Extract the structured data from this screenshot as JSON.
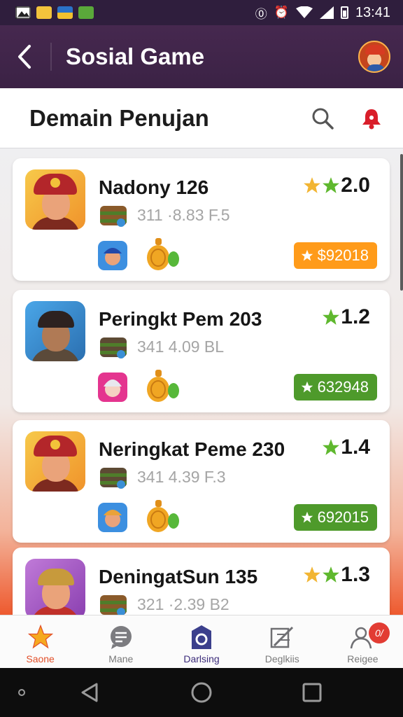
{
  "status_bar": {
    "time": "13:41",
    "icons": [
      "image-icon",
      "mail-icon",
      "flag-icon",
      "app-icon",
      "vibrate-icon",
      "alarm-icon",
      "wifi-icon",
      "signal-icon",
      "battery-icon"
    ]
  },
  "app_bar": {
    "title": "Sosial Game",
    "back_icon": "chevron-left-icon",
    "profile_icon": "profile-avatar"
  },
  "sub_header": {
    "title": "Demain Penujan",
    "search_icon": "search-icon",
    "notification_icon": "bell-icon"
  },
  "games": [
    {
      "name": "Nadony 126",
      "meta": "311 ·8.83 F.5",
      "rating": "2.0",
      "stars": 2,
      "star_colors": [
        "#f2b533",
        "#5fb82e"
      ],
      "price": "$92018",
      "price_color": "#ff9b1a"
    },
    {
      "name": "Peringkt Pem 203",
      "meta": "341 4.09 BL",
      "rating": "1.2",
      "stars": 1,
      "star_colors": [
        "#5fb82e"
      ],
      "price": "632948",
      "price_color": "#4e9a2b"
    },
    {
      "name": "Neringkat Peme 230",
      "meta": "341 4.39 F.3",
      "rating": "1.4",
      "stars": 1,
      "star_colors": [
        "#5fb82e"
      ],
      "price": "692015",
      "price_color": "#4e9a2b"
    },
    {
      "name": "DeningatSun 135",
      "meta": "321 ·2.39 B2",
      "rating": "1.3",
      "stars": 2,
      "star_colors": [
        "#f2b533",
        "#5fb82e"
      ],
      "price": "",
      "price_color": "#4e9a2b"
    }
  ],
  "bottom_nav": [
    {
      "label": "Saone",
      "icon": "star-icon"
    },
    {
      "label": "Mane",
      "icon": "chat-icon"
    },
    {
      "label": "Darlsing",
      "icon": "camera-icon"
    },
    {
      "label": "Deglkiis",
      "icon": "tools-icon"
    },
    {
      "label": "Reigee",
      "icon": "user-icon",
      "badge": "0/"
    }
  ],
  "colors": {
    "app_bar": "#3f2448",
    "accent_orange": "#ff9b1a",
    "accent_green": "#4e9a2b",
    "active_home": "#e2502a",
    "active_center": "#3b2b7a"
  }
}
